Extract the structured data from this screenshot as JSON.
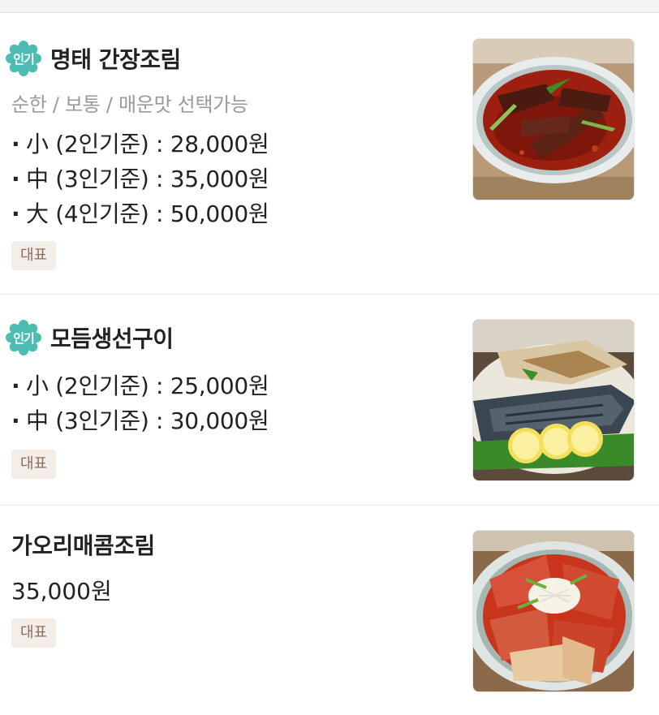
{
  "menu": {
    "items": [
      {
        "popular_badge": "인기",
        "name": "명태 간장조림",
        "description": "순한 / 보통 / 매운맛 선택가능",
        "prices": [
          {
            "bullet": "·",
            "text": "小 (2인기준) : 28,000원"
          },
          {
            "bullet": "·",
            "text": "中 (3인기준) : 35,000원"
          },
          {
            "bullet": "·",
            "text": "大 (4인기준) : 50,000원"
          }
        ],
        "tag": "대표",
        "image_alt": "명태 간장조림 photo"
      },
      {
        "popular_badge": "인기",
        "name": "모듬생선구이",
        "prices": [
          {
            "bullet": "·",
            "text": "小 (2인기준) : 25,000원"
          },
          {
            "bullet": "·",
            "text": "中 (3인기준) : 30,000원"
          }
        ],
        "tag": "대표",
        "image_alt": "모듬생선구이 photo"
      },
      {
        "name": "가오리매콤조림",
        "price": "35,000원",
        "tag": "대표",
        "image_alt": "가오리매콤조림 photo"
      }
    ]
  },
  "colors": {
    "popular_badge": "#4dbdb3",
    "tag_bg": "#f4eeea",
    "tag_text": "#8c6d5d",
    "description": "#9a9a9a"
  }
}
